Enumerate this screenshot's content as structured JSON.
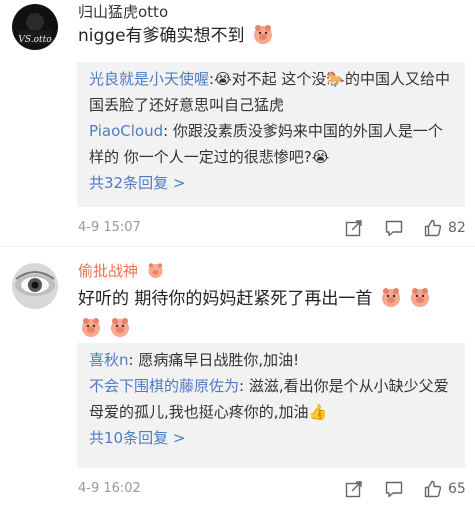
{
  "comments": [
    {
      "username": "归山猛虎otto",
      "text": "nigge有爹确实想不到",
      "replies": [
        {
          "user": "光良就是小天使喔",
          "text": ":😭对不起 这个没🐎的中国人又给中国丢脸了还好意思叫自己猛虎"
        },
        {
          "user": "PiaoCloud",
          "text": ": 你跟没素质没爹妈来中国的外国人是一个样的 你一个人一定过的很悲惨吧?😭"
        }
      ],
      "more_replies": "共32条回复 >",
      "timestamp": "4-9 15:07",
      "likes": "82"
    },
    {
      "username": "偷批战神",
      "text": "好听的 期待你的妈妈赶紧死了再出一首",
      "replies": [
        {
          "user": "喜秋n",
          "text": ": 愿病痛早日战胜你,加油!"
        },
        {
          "user": "不会下围棋的藤原佐为",
          "text": ": 滋滋,看出你是个从小缺少父爱母爱的孤儿,我也挺心疼你的,加油👍"
        }
      ],
      "more_replies": "共10条回复 >",
      "timestamp": "4-9 16:02",
      "likes": "65"
    }
  ],
  "icons": {
    "share": "share-icon",
    "reply": "reply-icon",
    "like": "thumbs-up-icon",
    "vip": "vip-badge-icon",
    "emoji": "pig-face-emoji"
  },
  "colors": {
    "link_blue": "#4f7bc1",
    "vip_orange": "#eb7350",
    "reply_bg": "#f2f2f2",
    "meta_gray": "#999999"
  },
  "avatar_text": "VS.otto"
}
